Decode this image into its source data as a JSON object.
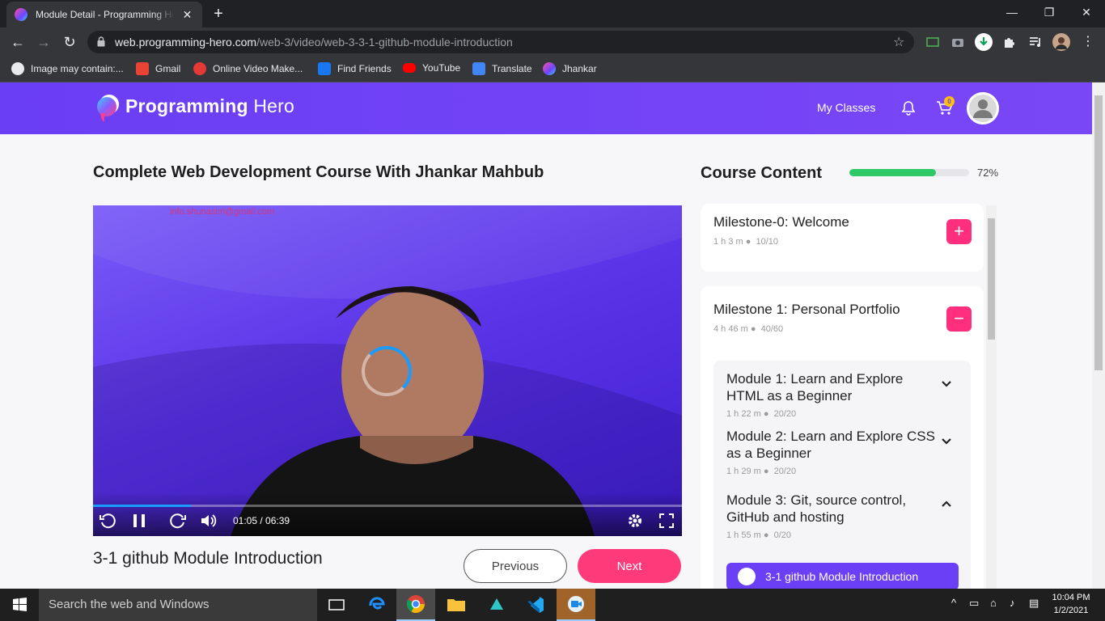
{
  "browser": {
    "tab_title": "Module Detail - Programming Hero",
    "tab_close": "✕",
    "new_tab": "+",
    "url_host": "web.programming-hero.com",
    "url_path": "/web-3/video/web-3-3-1-github-module-introduction",
    "bookmarks": [
      {
        "label": "Image may contain:...",
        "icon": "globe-icon",
        "color": "#e8eaed"
      },
      {
        "label": "Gmail",
        "icon": "gmail-icon",
        "color": "#ea4335"
      },
      {
        "label": "Online Video Make...",
        "icon": "video-maker-icon",
        "color": "#e53935"
      },
      {
        "label": "Find Friends",
        "icon": "facebook-icon",
        "color": "#1877f2"
      },
      {
        "label": "YouTube",
        "icon": "youtube-icon",
        "color": "#ff0000"
      },
      {
        "label": "Translate",
        "icon": "translate-icon",
        "color": "#4285f4"
      },
      {
        "label": "Jhankar",
        "icon": "programming-hero-icon",
        "color": "#7b5cff"
      }
    ]
  },
  "site": {
    "brand_bold": "Programming",
    "brand_light": "Hero",
    "nav_my_classes": "My Classes",
    "cart_count": "0",
    "accent": "#6a3ef5",
    "cta_color": "#ff3a7a"
  },
  "course": {
    "title": "Complete Web Development Course With Jhankar Mahbub"
  },
  "video": {
    "watermark": "info.shunasim@gmail.com",
    "time": "01:05 / 06:39",
    "progress": 0.166
  },
  "lesson": {
    "title": "3-1 github Module Introduction",
    "previous_label": "Previous",
    "next_label": "Next"
  },
  "course_content": {
    "title": "Course Content",
    "progress_percent": 72,
    "progress_label": "72%",
    "milestones": [
      {
        "name": "Milestone-0: Welcome",
        "duration": "1 h 3 m",
        "count": "10/10",
        "toggle": "+"
      },
      {
        "name": "Milestone 1: Personal Portfolio",
        "duration": "4 h 46 m",
        "count": "40/60",
        "toggle": "−"
      }
    ],
    "modules": [
      {
        "name": "Module 1: Learn and Explore HTML as a Beginner",
        "duration": "1 h 22 m",
        "count": "20/20"
      },
      {
        "name": "Module 2: Learn and Explore CSS as a Beginner",
        "duration": "1 h 29 m",
        "count": "20/20"
      },
      {
        "name": "Module 3: Git, source control, GitHub and hosting",
        "duration": "1 h 55 m",
        "count": "0/20"
      }
    ],
    "active_lesson": "3-1 github Module Introduction"
  },
  "taskbar": {
    "search_placeholder": "Search the web and Windows",
    "time": "10:04 PM",
    "date": "1/2/2021"
  }
}
